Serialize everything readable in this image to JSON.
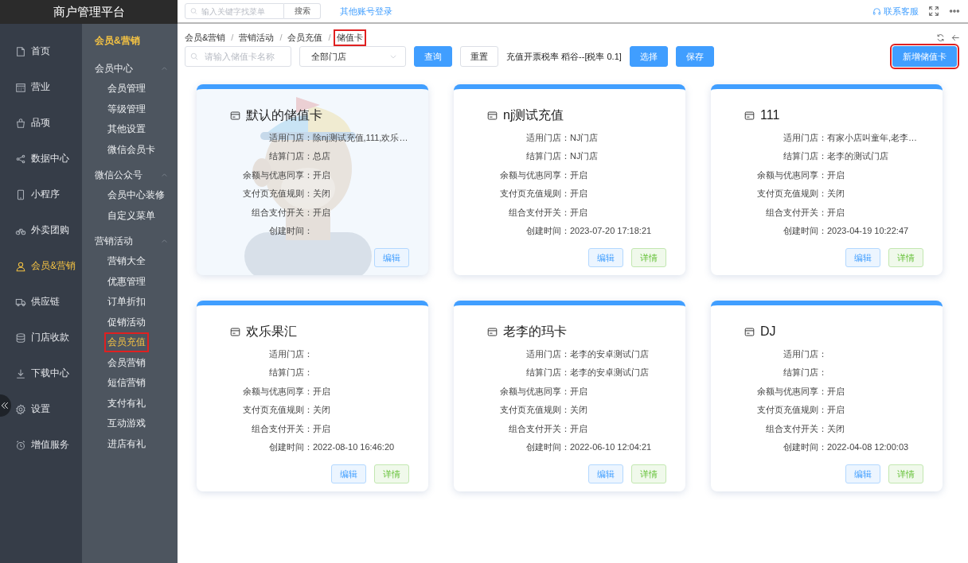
{
  "brand": "商户管理平台",
  "top_bar": {
    "search": {
      "placeholder": "输入关键字找菜单"
    },
    "search_button": "搜索",
    "link": "其他账号登录",
    "support": "联系客服"
  },
  "main_nav": [
    {
      "label": "首页",
      "selected": false
    },
    {
      "label": "营业",
      "selected": false
    },
    {
      "label": "品项",
      "selected": false
    },
    {
      "label": "数据中心",
      "selected": false
    },
    {
      "label": "小程序",
      "selected": false
    },
    {
      "label": "外卖团购",
      "selected": false
    },
    {
      "label": "会员&营销",
      "selected": true
    },
    {
      "label": "供应链",
      "selected": false
    },
    {
      "label": "门店收款",
      "selected": false
    },
    {
      "label": "下载中心",
      "selected": false
    },
    {
      "label": "设置",
      "selected": false
    },
    {
      "label": "增值服务",
      "selected": false
    }
  ],
  "sub_nav": {
    "title": "会员&营销",
    "groups": [
      {
        "label": "会员中心",
        "expanded": true,
        "children": [
          {
            "label": "会员管理",
            "selected": false,
            "highlighted": false
          },
          {
            "label": "等级管理",
            "selected": false,
            "highlighted": false
          },
          {
            "label": "其他设置",
            "selected": false,
            "highlighted": false
          },
          {
            "label": "微信会员卡",
            "selected": false,
            "highlighted": false
          }
        ]
      },
      {
        "label": "微信公众号",
        "expanded": true,
        "children": [
          {
            "label": "会员中心装修",
            "selected": false,
            "highlighted": false
          },
          {
            "label": "自定义菜单",
            "selected": false,
            "highlighted": false
          }
        ]
      },
      {
        "label": "营销活动",
        "expanded": true,
        "children": [
          {
            "label": "营销大全",
            "selected": false,
            "highlighted": false
          },
          {
            "label": "优惠管理",
            "selected": false,
            "highlighted": false
          },
          {
            "label": "订单折扣",
            "selected": false,
            "highlighted": false
          },
          {
            "label": "促销活动",
            "selected": false,
            "highlighted": false
          },
          {
            "label": "会员充值",
            "selected": true,
            "highlighted": true
          },
          {
            "label": "会员营销",
            "selected": false,
            "highlighted": false
          },
          {
            "label": "短信营销",
            "selected": false,
            "highlighted": false
          },
          {
            "label": "支付有礼",
            "selected": false,
            "highlighted": false
          },
          {
            "label": "互动游戏",
            "selected": false,
            "highlighted": false
          },
          {
            "label": "进店有礼",
            "selected": false,
            "highlighted": false
          }
        ]
      }
    ]
  },
  "breadcrumb_separator": "/",
  "breadcrumb": [
    {
      "label": "会员&营销",
      "highlighted": false
    },
    {
      "label": "营销活动",
      "highlighted": false
    },
    {
      "label": "会员充值",
      "highlighted": false
    },
    {
      "label": "储值卡",
      "highlighted": true
    }
  ],
  "toolbar": {
    "name_search": {
      "placeholder": "请输入储值卡名称"
    },
    "store_select": "全部门店",
    "query_button": "查询",
    "reset_button": "重置",
    "tax_label": "充值开票税率 稻谷--[税率 0.1]",
    "choose_button": "选择",
    "save_button": "保存",
    "add_button": {
      "label": "新增储值卡",
      "highlighted": true
    }
  },
  "cards": [
    {
      "title": "默认的储值卡",
      "background": {
        "kind": "picture"
      },
      "fields": [
        {
          "label": "适用门店：",
          "value": "除nj测试充值,111,欢乐…"
        },
        {
          "label": "结算门店：",
          "value": "总店"
        },
        {
          "label": "余额与优惠同享：",
          "value": "开启"
        },
        {
          "label": "支付页充值规则：",
          "value": "关闭"
        },
        {
          "label": "组合支付开关：",
          "value": "开启"
        },
        {
          "label": "创建时间："
        }
      ],
      "buttons": [
        {
          "label": "编辑",
          "kind": "edit"
        }
      ]
    },
    {
      "title": "nj测试充值",
      "fields": [
        {
          "label": "适用门店：",
          "value": "NJ门店"
        },
        {
          "label": "结算门店：",
          "value": "NJ门店"
        },
        {
          "label": "余额与优惠同享：",
          "value": "开启"
        },
        {
          "label": "支付页充值规则：",
          "value": "开启"
        },
        {
          "label": "组合支付开关：",
          "value": "开启"
        },
        {
          "label": "创建时间：",
          "value": "2023-07-20 17:18:21"
        }
      ],
      "buttons": [
        {
          "label": "编辑",
          "kind": "edit"
        },
        {
          "label": "详情",
          "kind": "detail"
        }
      ]
    },
    {
      "title": "111",
      "fields": [
        {
          "label": "适用门店：",
          "value": "有家小店叫童年,老李…"
        },
        {
          "label": "结算门店：",
          "value": "老李的测试门店"
        },
        {
          "label": "余额与优惠同享：",
          "value": "开启"
        },
        {
          "label": "支付页充值规则：",
          "value": "关闭"
        },
        {
          "label": "组合支付开关：",
          "value": "开启"
        },
        {
          "label": "创建时间：",
          "value": "2023-04-19 10:22:47"
        }
      ],
      "buttons": [
        {
          "label": "编辑",
          "kind": "edit"
        },
        {
          "label": "详情",
          "kind": "detail"
        }
      ]
    },
    {
      "title": "欢乐果汇",
      "fields": [
        {
          "label": "适用门店："
        },
        {
          "label": "结算门店："
        },
        {
          "label": "余额与优惠同享：",
          "value": "开启"
        },
        {
          "label": "支付页充值规则：",
          "value": "关闭"
        },
        {
          "label": "组合支付开关：",
          "value": "开启"
        },
        {
          "label": "创建时间：",
          "value": "2022-08-10 16:46:20"
        }
      ],
      "buttons": [
        {
          "label": "编辑",
          "kind": "edit"
        },
        {
          "label": "详情",
          "kind": "detail"
        }
      ]
    },
    {
      "title": "老李的玛卡",
      "fields": [
        {
          "label": "适用门店：",
          "value": "老李的安卓测试门店"
        },
        {
          "label": "结算门店：",
          "value": "老李的安卓测试门店"
        },
        {
          "label": "余额与优惠同享：",
          "value": "开启"
        },
        {
          "label": "支付页充值规则：",
          "value": "关闭"
        },
        {
          "label": "组合支付开关：",
          "value": "开启"
        },
        {
          "label": "创建时间：",
          "value": "2022-06-10 12:04:21"
        }
      ],
      "buttons": [
        {
          "label": "编辑",
          "kind": "edit"
        },
        {
          "label": "详情",
          "kind": "detail"
        }
      ]
    },
    {
      "title": "DJ",
      "fields": [
        {
          "label": "适用门店："
        },
        {
          "label": "结算门店："
        },
        {
          "label": "余额与优惠同享：",
          "value": "开启"
        },
        {
          "label": "支付页充值规则：",
          "value": "开启"
        },
        {
          "label": "组合支付开关：",
          "value": "关闭"
        },
        {
          "label": "创建时间：",
          "value": "2022-04-08 12:00:03"
        }
      ],
      "buttons": [
        {
          "label": "编辑",
          "kind": "edit"
        },
        {
          "label": "详情",
          "kind": "detail"
        }
      ]
    }
  ]
}
